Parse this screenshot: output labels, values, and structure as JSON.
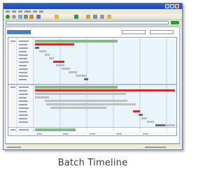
{
  "caption": "Batch Timeline",
  "colors": {
    "titlebar": "#1d49a8",
    "lane_bg": "#e9f4fb",
    "header_green": "#87b88a",
    "bar_green": "#7fbf72",
    "bar_red": "#c8322a",
    "bar_gray": "#bfbfbf",
    "bar_dark": "#6e6e6e"
  }
}
